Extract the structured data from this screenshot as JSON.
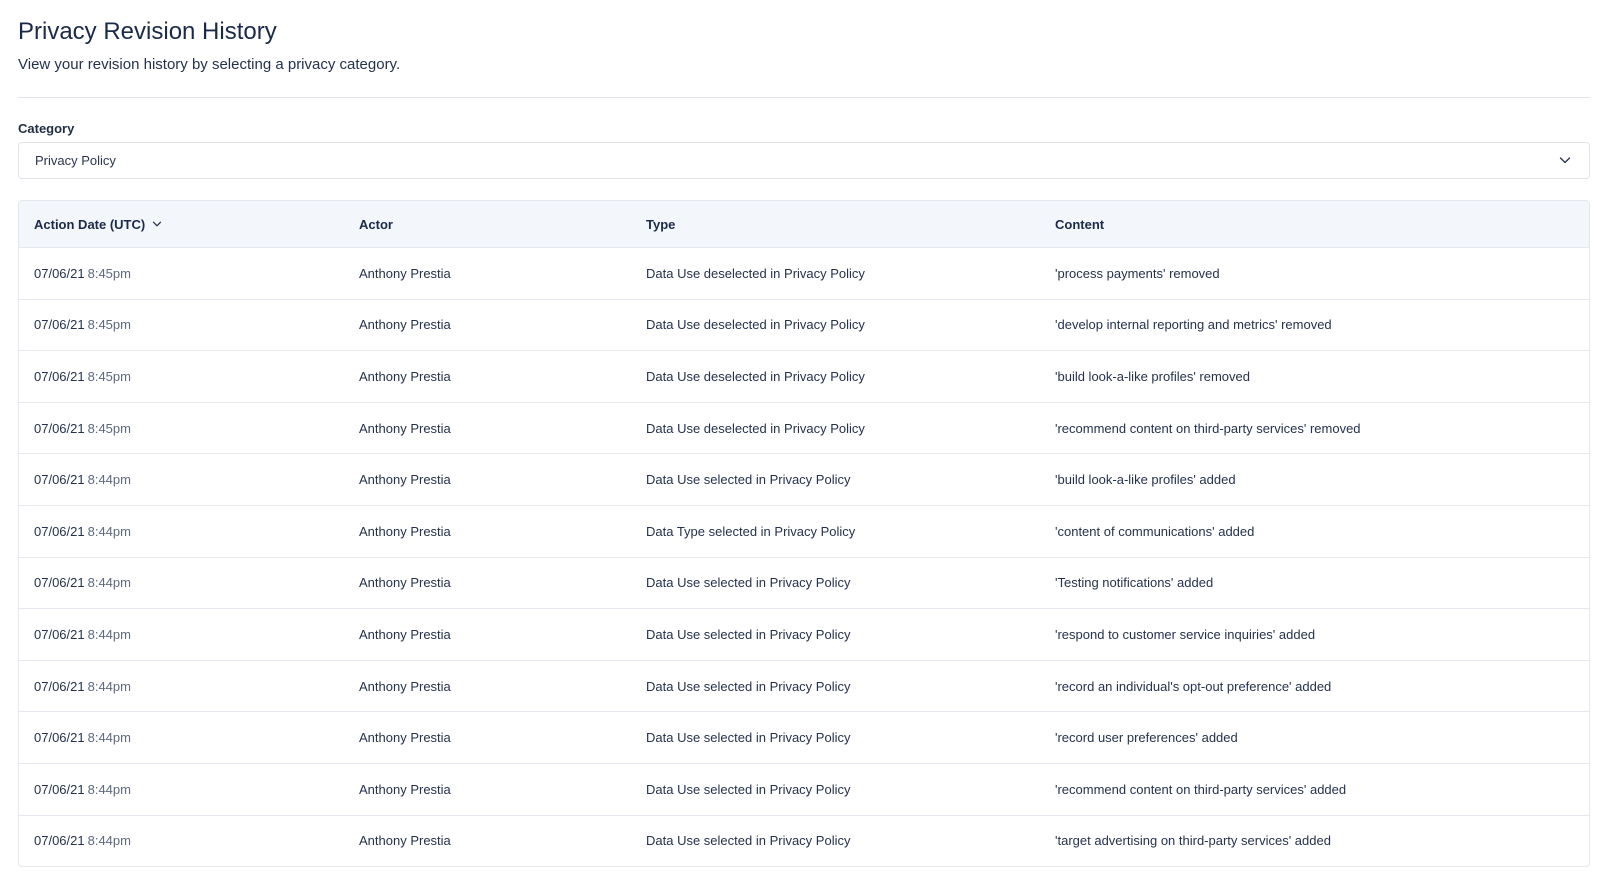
{
  "page": {
    "title": "Privacy Revision History",
    "subtitle": "View your revision history by selecting a privacy category."
  },
  "category": {
    "label": "Category",
    "selected": "Privacy Policy",
    "icon": "chevron-down-icon"
  },
  "table": {
    "columns": {
      "date": "Action Date (UTC)",
      "actor": "Actor",
      "type": "Type",
      "content": "Content"
    },
    "sort_icon": "chevron-down-icon",
    "rows": [
      {
        "date": "07/06/21",
        "time": "8:45pm",
        "actor": "Anthony Prestia",
        "type": "Data Use deselected in Privacy Policy",
        "content": "'process payments' removed"
      },
      {
        "date": "07/06/21",
        "time": "8:45pm",
        "actor": "Anthony Prestia",
        "type": "Data Use deselected in Privacy Policy",
        "content": "'develop internal reporting and metrics' removed"
      },
      {
        "date": "07/06/21",
        "time": "8:45pm",
        "actor": "Anthony Prestia",
        "type": "Data Use deselected in Privacy Policy",
        "content": "'build look-a-like profiles' removed"
      },
      {
        "date": "07/06/21",
        "time": "8:45pm",
        "actor": "Anthony Prestia",
        "type": "Data Use deselected in Privacy Policy",
        "content": "'recommend content on third-party services' removed"
      },
      {
        "date": "07/06/21",
        "time": "8:44pm",
        "actor": "Anthony Prestia",
        "type": "Data Use selected in Privacy Policy",
        "content": "'build look-a-like profiles' added"
      },
      {
        "date": "07/06/21",
        "time": "8:44pm",
        "actor": "Anthony Prestia",
        "type": "Data Type selected in Privacy Policy",
        "content": "'content of communications' added"
      },
      {
        "date": "07/06/21",
        "time": "8:44pm",
        "actor": "Anthony Prestia",
        "type": "Data Use selected in Privacy Policy",
        "content": "'Testing notifications' added"
      },
      {
        "date": "07/06/21",
        "time": "8:44pm",
        "actor": "Anthony Prestia",
        "type": "Data Use selected in Privacy Policy",
        "content": "'respond to customer service inquiries' added"
      },
      {
        "date": "07/06/21",
        "time": "8:44pm",
        "actor": "Anthony Prestia",
        "type": "Data Use selected in Privacy Policy",
        "content": "'record an individual's opt-out preference' added"
      },
      {
        "date": "07/06/21",
        "time": "8:44pm",
        "actor": "Anthony Prestia",
        "type": "Data Use selected in Privacy Policy",
        "content": "'record user preferences' added"
      },
      {
        "date": "07/06/21",
        "time": "8:44pm",
        "actor": "Anthony Prestia",
        "type": "Data Use selected in Privacy Policy",
        "content": "'recommend content on third-party services' added"
      },
      {
        "date": "07/06/21",
        "time": "8:44pm",
        "actor": "Anthony Prestia",
        "type": "Data Use selected in Privacy Policy",
        "content": "'target advertising on third-party services' added"
      }
    ]
  }
}
